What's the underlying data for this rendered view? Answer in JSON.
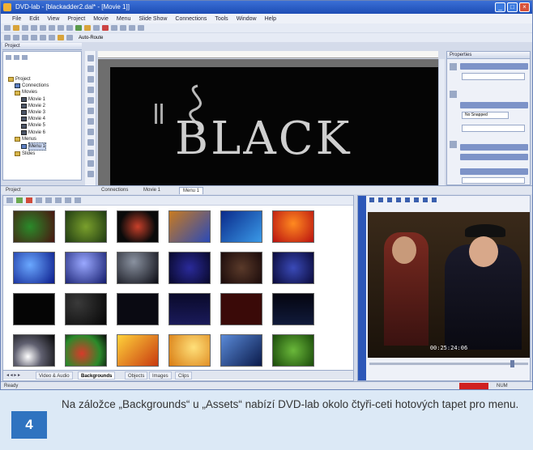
{
  "window": {
    "title": "DVD-lab - [blackadder2.dal* - [Movie 1]]"
  },
  "menu": [
    "File",
    "Edit",
    "View",
    "Project",
    "Movie",
    "Menu",
    "Slide Show",
    "Connections",
    "Tools",
    "Window",
    "Help"
  ],
  "project_panel": {
    "title": "Project",
    "tree": [
      {
        "label": "Project",
        "level": 0,
        "icon": "folder"
      },
      {
        "label": "Connections",
        "level": 1,
        "icon": "link"
      },
      {
        "label": "Movies",
        "level": 1,
        "icon": "folder"
      },
      {
        "label": "Movie 1",
        "level": 2,
        "icon": "movie"
      },
      {
        "label": "Movie 2",
        "level": 2,
        "icon": "movie"
      },
      {
        "label": "Movie 3",
        "level": 2,
        "icon": "movie"
      },
      {
        "label": "Movie 4",
        "level": 2,
        "icon": "movie"
      },
      {
        "label": "Movie 5",
        "level": 2,
        "icon": "movie"
      },
      {
        "label": "Movie 6",
        "level": 2,
        "icon": "movie"
      },
      {
        "label": "Menus",
        "level": 1,
        "icon": "folder"
      },
      {
        "label": "Menu 1",
        "level": 2,
        "icon": "menu"
      },
      {
        "label": "Slides",
        "level": 1,
        "icon": "folder"
      }
    ]
  },
  "canvas": {
    "text": "BLACK",
    "toolbar_text": "Auto-Route"
  },
  "properties": {
    "title": "Properties",
    "button_label": "No Snapped"
  },
  "doc_tabs": [
    "Project",
    "Connections",
    "Movie 1",
    "Menu 1"
  ],
  "assets": {
    "tabs": [
      "Video & Audio",
      "Backgrounds",
      "Objects",
      "Images",
      "Clips"
    ],
    "active_tab": "Backgrounds"
  },
  "preview": {
    "timecode": "00:25:24:06",
    "position": 0.9
  },
  "status": {
    "text": "Ready",
    "mode": "NUM"
  },
  "caption": {
    "number": "4",
    "text": "Na záložce „Backgrounds“ u „Assets“ nabízí DVD-lab okolo čtyři-ceti hotových tapet pro menu."
  }
}
